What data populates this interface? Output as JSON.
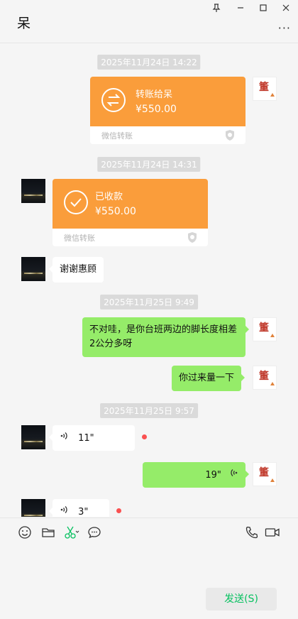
{
  "window": {
    "title": "呆",
    "controls": [
      "pin-icon",
      "minimize-icon",
      "maximize-icon",
      "close-icon"
    ],
    "more": "···"
  },
  "messages": {
    "ts1": "2025年11月24日 14:22",
    "transfer_sent": {
      "title": "转账给呆",
      "amount": "¥550.00",
      "brand": "微信转账"
    },
    "ts2": "2025年11月24日 14:31",
    "transfer_received": {
      "title": "已收款",
      "amount": "¥550.00",
      "brand": "微信转账"
    },
    "thanks": "谢谢惠顾",
    "ts3": "2025年11月25日 9:49",
    "msg_right_1": "不对哇，是你台班两边的脚长度相差2公分多呀",
    "msg_right_2": "你过来量一下",
    "ts4": "2025年11月25日 9:57",
    "voice_left_1": "11\"",
    "voice_right_1": "19\"",
    "voice_left_2": "3\""
  },
  "avatar_seal": "箽",
  "toolbar": {
    "icons": [
      "emoji-icon",
      "folder-icon",
      "scissors-icon",
      "chat-bubble-icon",
      "phone-icon",
      "video-call-icon"
    ]
  },
  "send_label": "发送(S)",
  "colors": {
    "accent_green": "#07c160",
    "bubble_green": "#95ec69",
    "transfer_orange": "#fa9d3b",
    "unread_red": "#fa5151"
  }
}
